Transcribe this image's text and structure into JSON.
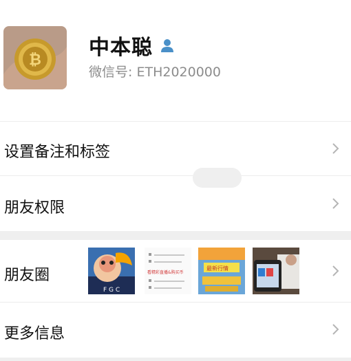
{
  "profile": {
    "name": "中本聪",
    "wechat_id_label": "微信号: ",
    "wechat_id": "ETH2020000",
    "avatar_icon": "gold-bitcoin-coin-avatar",
    "badge_icon": "person-icon"
  },
  "menu": {
    "remark_tags": "设置备注和标签",
    "friend_permissions": "朋友权限",
    "moments": "朋友圈",
    "more_info": "更多信息"
  },
  "moments_thumbs": {
    "thumb1_text": "F G C",
    "thumb2_text": "看精彩直播&购买币",
    "thumb3_text": "最新行情",
    "thumb4_text": ""
  },
  "colors": {
    "background": "#ffffff",
    "separator": "#efefef",
    "secondary_text": "#8c8c8c",
    "icon_blue": "#4a90c8"
  }
}
